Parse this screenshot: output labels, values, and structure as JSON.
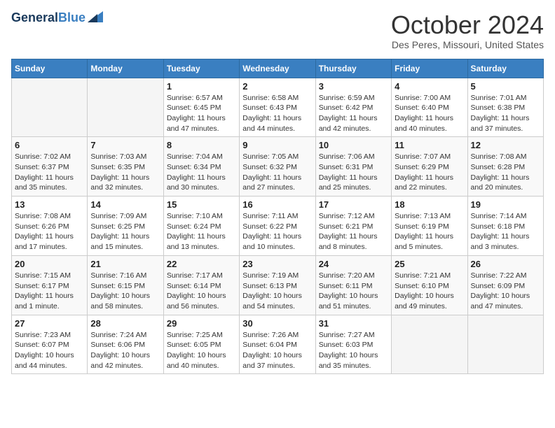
{
  "header": {
    "logo_line1": "General",
    "logo_line2": "Blue",
    "month": "October 2024",
    "location": "Des Peres, Missouri, United States"
  },
  "weekdays": [
    "Sunday",
    "Monday",
    "Tuesday",
    "Wednesday",
    "Thursday",
    "Friday",
    "Saturday"
  ],
  "weeks": [
    [
      {
        "day": "",
        "info": ""
      },
      {
        "day": "",
        "info": ""
      },
      {
        "day": "1",
        "info": "Sunrise: 6:57 AM\nSunset: 6:45 PM\nDaylight: 11 hours and 47 minutes."
      },
      {
        "day": "2",
        "info": "Sunrise: 6:58 AM\nSunset: 6:43 PM\nDaylight: 11 hours and 44 minutes."
      },
      {
        "day": "3",
        "info": "Sunrise: 6:59 AM\nSunset: 6:42 PM\nDaylight: 11 hours and 42 minutes."
      },
      {
        "day": "4",
        "info": "Sunrise: 7:00 AM\nSunset: 6:40 PM\nDaylight: 11 hours and 40 minutes."
      },
      {
        "day": "5",
        "info": "Sunrise: 7:01 AM\nSunset: 6:38 PM\nDaylight: 11 hours and 37 minutes."
      }
    ],
    [
      {
        "day": "6",
        "info": "Sunrise: 7:02 AM\nSunset: 6:37 PM\nDaylight: 11 hours and 35 minutes."
      },
      {
        "day": "7",
        "info": "Sunrise: 7:03 AM\nSunset: 6:35 PM\nDaylight: 11 hours and 32 minutes."
      },
      {
        "day": "8",
        "info": "Sunrise: 7:04 AM\nSunset: 6:34 PM\nDaylight: 11 hours and 30 minutes."
      },
      {
        "day": "9",
        "info": "Sunrise: 7:05 AM\nSunset: 6:32 PM\nDaylight: 11 hours and 27 minutes."
      },
      {
        "day": "10",
        "info": "Sunrise: 7:06 AM\nSunset: 6:31 PM\nDaylight: 11 hours and 25 minutes."
      },
      {
        "day": "11",
        "info": "Sunrise: 7:07 AM\nSunset: 6:29 PM\nDaylight: 11 hours and 22 minutes."
      },
      {
        "day": "12",
        "info": "Sunrise: 7:08 AM\nSunset: 6:28 PM\nDaylight: 11 hours and 20 minutes."
      }
    ],
    [
      {
        "day": "13",
        "info": "Sunrise: 7:08 AM\nSunset: 6:26 PM\nDaylight: 11 hours and 17 minutes."
      },
      {
        "day": "14",
        "info": "Sunrise: 7:09 AM\nSunset: 6:25 PM\nDaylight: 11 hours and 15 minutes."
      },
      {
        "day": "15",
        "info": "Sunrise: 7:10 AM\nSunset: 6:24 PM\nDaylight: 11 hours and 13 minutes."
      },
      {
        "day": "16",
        "info": "Sunrise: 7:11 AM\nSunset: 6:22 PM\nDaylight: 11 hours and 10 minutes."
      },
      {
        "day": "17",
        "info": "Sunrise: 7:12 AM\nSunset: 6:21 PM\nDaylight: 11 hours and 8 minutes."
      },
      {
        "day": "18",
        "info": "Sunrise: 7:13 AM\nSunset: 6:19 PM\nDaylight: 11 hours and 5 minutes."
      },
      {
        "day": "19",
        "info": "Sunrise: 7:14 AM\nSunset: 6:18 PM\nDaylight: 11 hours and 3 minutes."
      }
    ],
    [
      {
        "day": "20",
        "info": "Sunrise: 7:15 AM\nSunset: 6:17 PM\nDaylight: 11 hours and 1 minute."
      },
      {
        "day": "21",
        "info": "Sunrise: 7:16 AM\nSunset: 6:15 PM\nDaylight: 10 hours and 58 minutes."
      },
      {
        "day": "22",
        "info": "Sunrise: 7:17 AM\nSunset: 6:14 PM\nDaylight: 10 hours and 56 minutes."
      },
      {
        "day": "23",
        "info": "Sunrise: 7:19 AM\nSunset: 6:13 PM\nDaylight: 10 hours and 54 minutes."
      },
      {
        "day": "24",
        "info": "Sunrise: 7:20 AM\nSunset: 6:11 PM\nDaylight: 10 hours and 51 minutes."
      },
      {
        "day": "25",
        "info": "Sunrise: 7:21 AM\nSunset: 6:10 PM\nDaylight: 10 hours and 49 minutes."
      },
      {
        "day": "26",
        "info": "Sunrise: 7:22 AM\nSunset: 6:09 PM\nDaylight: 10 hours and 47 minutes."
      }
    ],
    [
      {
        "day": "27",
        "info": "Sunrise: 7:23 AM\nSunset: 6:07 PM\nDaylight: 10 hours and 44 minutes."
      },
      {
        "day": "28",
        "info": "Sunrise: 7:24 AM\nSunset: 6:06 PM\nDaylight: 10 hours and 42 minutes."
      },
      {
        "day": "29",
        "info": "Sunrise: 7:25 AM\nSunset: 6:05 PM\nDaylight: 10 hours and 40 minutes."
      },
      {
        "day": "30",
        "info": "Sunrise: 7:26 AM\nSunset: 6:04 PM\nDaylight: 10 hours and 37 minutes."
      },
      {
        "day": "31",
        "info": "Sunrise: 7:27 AM\nSunset: 6:03 PM\nDaylight: 10 hours and 35 minutes."
      },
      {
        "day": "",
        "info": ""
      },
      {
        "day": "",
        "info": ""
      }
    ]
  ]
}
